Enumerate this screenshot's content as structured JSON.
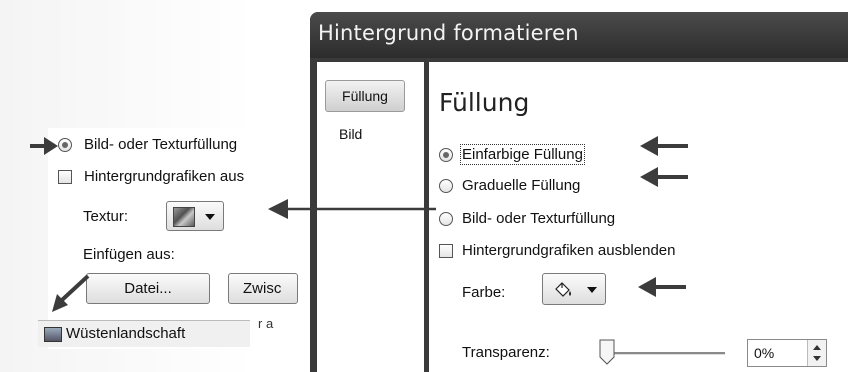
{
  "inset": {
    "radio_label": "Bild- oder Texturfüllung",
    "checkbox_label": "Hintergrundgrafiken aus",
    "texture_label": "Textur:",
    "insert_from_label": "Einfügen aus:",
    "file_button": "Datei...",
    "clipboard_button": "Zwisc",
    "dropdown_item": "Wüstenlandschaft",
    "dropdown_trailing": "r a"
  },
  "dialog": {
    "title": "Hintergrund formatieren",
    "tabs": [
      {
        "label": "Füllung"
      },
      {
        "label": "Bild"
      }
    ],
    "heading": "Füllung",
    "options": [
      {
        "label": "Einfarbige Füllung"
      },
      {
        "label": "Graduelle Füllung"
      },
      {
        "label": "Bild- oder Texturfüllung"
      }
    ],
    "hide_graphics_label": "Hintergrundgrafiken ausblenden",
    "color_label": "Farbe:",
    "transparency_label": "Transparenz:",
    "transparency_value": "0%"
  },
  "state": {
    "selected_option": "Einfarbige Füllung",
    "hide_graphics_checked": false,
    "inset_radio_selected": true,
    "transparency_percent": 0
  },
  "colors": {
    "titlebar": "#3a3a3a",
    "arrow": "#3c3c3c",
    "background": "#ffffff"
  },
  "icons": [
    "texture-icon",
    "paint-bucket-icon",
    "picture-icon"
  ]
}
